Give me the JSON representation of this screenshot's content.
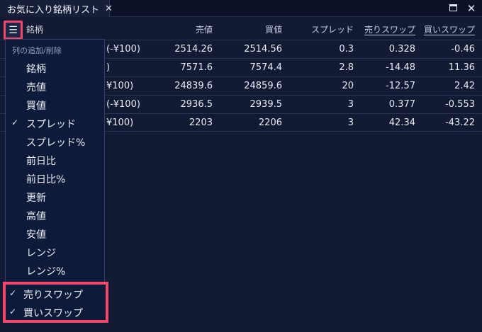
{
  "window": {
    "tab_title": "お気に入り銘柄リスト",
    "tab_close_glyph": "✕",
    "close_glyph": "✕"
  },
  "menu_button_glyph": "☰",
  "table": {
    "headers": [
      "銘柄",
      "売値",
      "買値",
      "スプレッド",
      "売りスワップ",
      "買いスワップ"
    ],
    "rows": [
      [
        "(-¥100)",
        "2514.26",
        "2514.56",
        "0.3",
        "0.328",
        "-0.46"
      ],
      [
        ")",
        "7571.6",
        "7574.4",
        "2.8",
        "-14.48",
        "11.36"
      ],
      [
        "¥100)",
        "24839.6",
        "24859.6",
        "20",
        "-12.57",
        "2.42"
      ],
      [
        "(-¥100)",
        "2936.5",
        "2939.5",
        "3",
        "0.377",
        "-0.553"
      ],
      [
        "¥100)",
        "2203",
        "2206",
        "3",
        "42.34",
        "-43.22"
      ]
    ]
  },
  "column_menu": {
    "title": "列の追加/削除",
    "check_glyph": "✓",
    "items": [
      {
        "label": "銘柄",
        "checked": false
      },
      {
        "label": "売値",
        "checked": false
      },
      {
        "label": "買値",
        "checked": false
      },
      {
        "label": "スプレッド",
        "checked": true
      },
      {
        "label": "スプレッド%",
        "checked": false
      },
      {
        "label": "前日比",
        "checked": false
      },
      {
        "label": "前日比%",
        "checked": false
      },
      {
        "label": "更新",
        "checked": false
      },
      {
        "label": "高値",
        "checked": false
      },
      {
        "label": "安値",
        "checked": false
      },
      {
        "label": "レンジ",
        "checked": false
      },
      {
        "label": "レンジ%",
        "checked": false
      }
    ],
    "swap_items": [
      {
        "label": "売りスワップ",
        "checked": true
      },
      {
        "label": "買いスワップ",
        "checked": true
      }
    ]
  },
  "colors": {
    "background": "#131a33",
    "highlight": "#f2466a",
    "menu_bg": "#0e1a3a"
  }
}
